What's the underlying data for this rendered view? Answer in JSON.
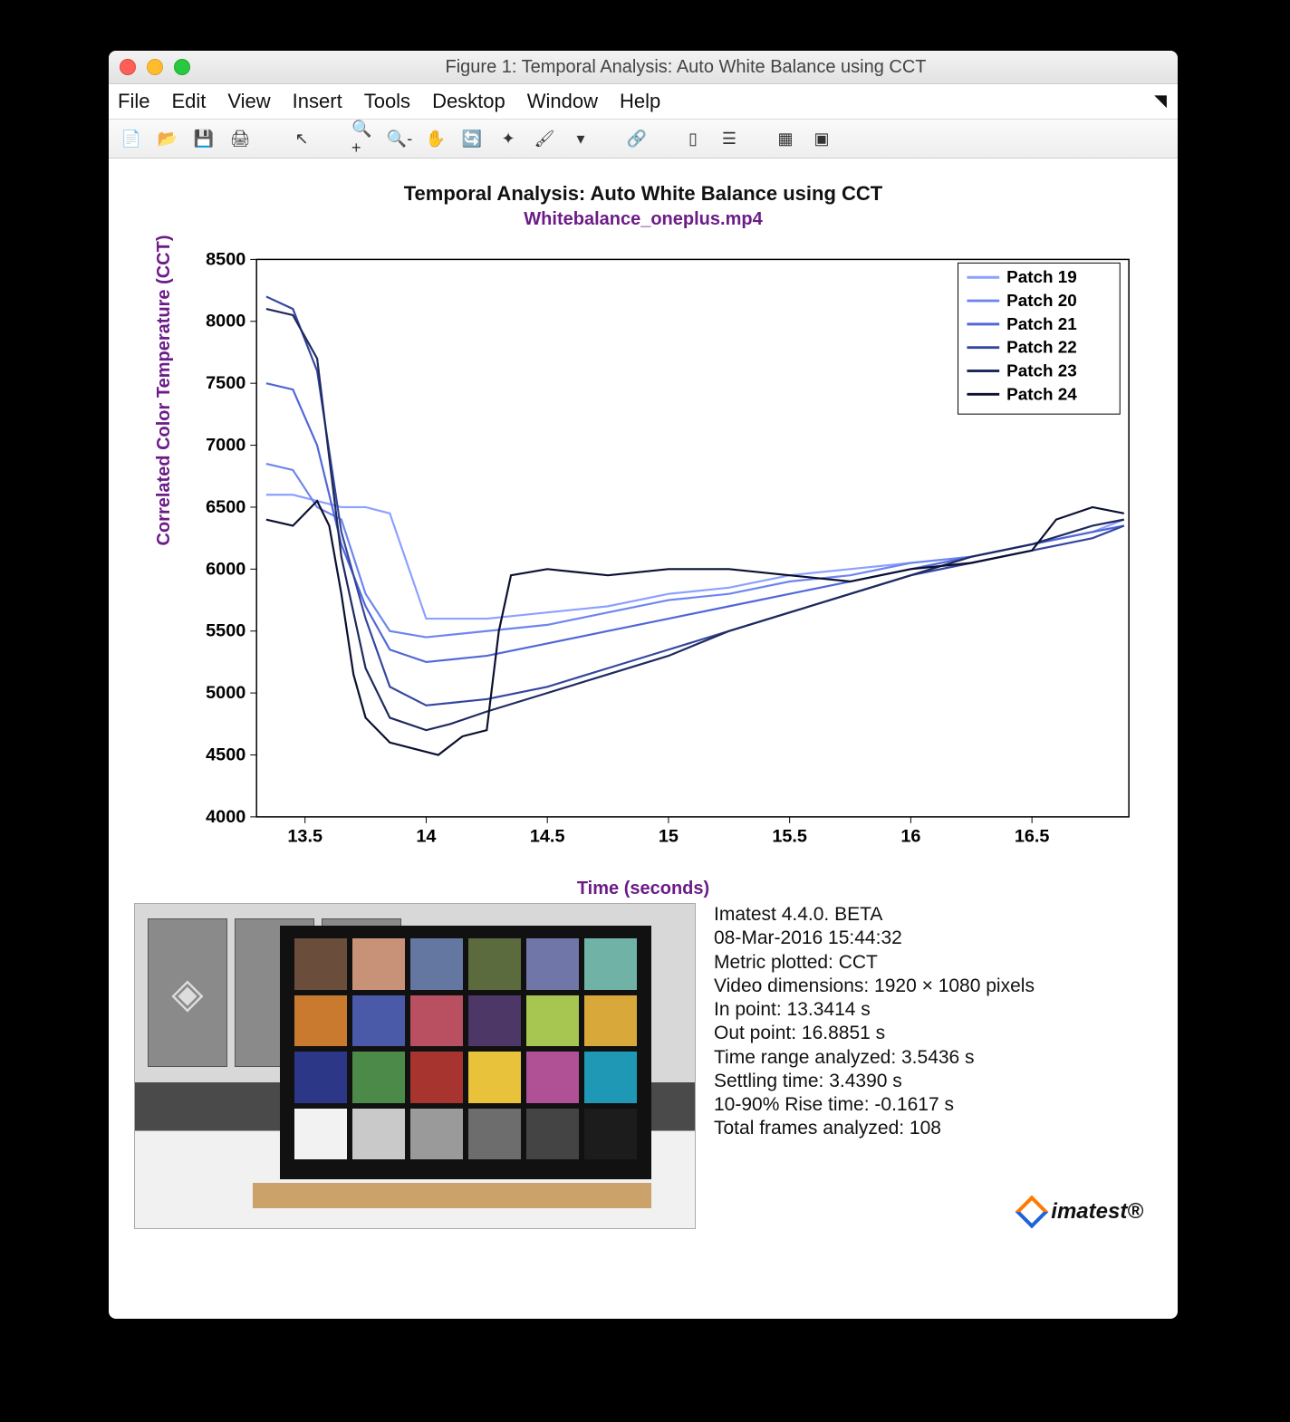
{
  "window": {
    "title": "Figure 1: Temporal Analysis: Auto White Balance using CCT"
  },
  "menu": [
    "File",
    "Edit",
    "View",
    "Insert",
    "Tools",
    "Desktop",
    "Window",
    "Help"
  ],
  "chart": {
    "title": "Temporal Analysis: Auto White Balance using CCT",
    "subtitle": "Whitebalance_oneplus.mp4",
    "ylabel": "Correlated Color Temperature (CCT)",
    "xlabel": "Time (seconds)"
  },
  "info": {
    "l1": "Imatest 4.4.0. BETA",
    "l2": "08-Mar-2016 15:44:32",
    "l3": "Metric plotted: CCT",
    "l4": "Video dimensions: 1920 × 1080 pixels",
    "l5": "In point: 13.3414 s",
    "l6": "Out point: 16.8851 s",
    "l7": "Time range analyzed: 3.5436 s",
    "l8": "Settling time: 3.4390 s",
    "l9": "10-90% Rise time: -0.1617 s",
    "l10": "Total frames analyzed: 108"
  },
  "logo": "imatest®",
  "chart_data": {
    "type": "line",
    "xlabel": "Time (seconds)",
    "ylabel": "Correlated Color Temperature (CCT)",
    "xlim": [
      13.3,
      16.9
    ],
    "ylim": [
      4000,
      8500
    ],
    "xticks": [
      13.5,
      14,
      14.5,
      15,
      15.5,
      16,
      16.5
    ],
    "yticks": [
      4000,
      4500,
      5000,
      5500,
      6000,
      6500,
      7000,
      7500,
      8000,
      8500
    ],
    "legend_position": "top-right",
    "series": [
      {
        "name": "Patch 19",
        "color": "#8ca0ff",
        "x": [
          13.34,
          13.45,
          13.55,
          13.65,
          13.75,
          13.85,
          14.0,
          14.25,
          14.5,
          14.75,
          15.0,
          15.25,
          15.5,
          15.75,
          16.0,
          16.25,
          16.5,
          16.75,
          16.88
        ],
        "y": [
          6600,
          6600,
          6550,
          6500,
          6500,
          6450,
          5600,
          5600,
          5650,
          5700,
          5800,
          5850,
          5950,
          6000,
          6050,
          6100,
          6200,
          6300,
          6400
        ]
      },
      {
        "name": "Patch 20",
        "color": "#6d85ef",
        "x": [
          13.34,
          13.45,
          13.55,
          13.65,
          13.75,
          13.85,
          14.0,
          14.25,
          14.5,
          14.75,
          15.0,
          15.25,
          15.5,
          15.75,
          16.0,
          16.25,
          16.5,
          16.75,
          16.88
        ],
        "y": [
          6850,
          6800,
          6500,
          6400,
          5800,
          5500,
          5450,
          5500,
          5550,
          5650,
          5750,
          5800,
          5900,
          5950,
          6050,
          6100,
          6200,
          6300,
          6350
        ]
      },
      {
        "name": "Patch 21",
        "color": "#5167d8",
        "x": [
          13.34,
          13.45,
          13.55,
          13.65,
          13.75,
          13.85,
          14.0,
          14.25,
          14.5,
          14.75,
          15.0,
          15.25,
          15.5,
          15.75,
          16.0,
          16.25,
          16.5,
          16.75,
          16.88
        ],
        "y": [
          7500,
          7450,
          7000,
          6200,
          5700,
          5350,
          5250,
          5300,
          5400,
          5500,
          5600,
          5700,
          5800,
          5900,
          6000,
          6100,
          6200,
          6300,
          6350
        ]
      },
      {
        "name": "Patch 22",
        "color": "#34469f",
        "x": [
          13.34,
          13.45,
          13.55,
          13.65,
          13.75,
          13.85,
          14.0,
          14.25,
          14.5,
          14.75,
          15.0,
          15.25,
          15.5,
          15.75,
          16.0,
          16.25,
          16.5,
          16.75,
          16.88
        ],
        "y": [
          8200,
          8100,
          7600,
          6300,
          5600,
          5050,
          4900,
          4950,
          5050,
          5200,
          5350,
          5500,
          5650,
          5800,
          5950,
          6050,
          6150,
          6250,
          6350
        ]
      },
      {
        "name": "Patch 23",
        "color": "#1e2a5e",
        "x": [
          13.34,
          13.45,
          13.55,
          13.65,
          13.75,
          13.85,
          14.0,
          14.1,
          14.25,
          14.5,
          14.75,
          15.0,
          15.25,
          15.5,
          15.75,
          16.0,
          16.25,
          16.5,
          16.75,
          16.88
        ],
        "y": [
          8100,
          8050,
          7700,
          6100,
          5200,
          4800,
          4700,
          4750,
          4850,
          5000,
          5150,
          5300,
          5500,
          5650,
          5800,
          5950,
          6100,
          6200,
          6350,
          6400
        ]
      },
      {
        "name": "Patch 24",
        "color": "#0b1030",
        "x": [
          13.34,
          13.45,
          13.55,
          13.6,
          13.65,
          13.7,
          13.75,
          13.85,
          13.95,
          14.05,
          14.15,
          14.25,
          14.3,
          14.35,
          14.5,
          14.75,
          15.0,
          15.25,
          15.5,
          15.75,
          16.0,
          16.25,
          16.5,
          16.6,
          16.75,
          16.88
        ],
        "y": [
          6400,
          6350,
          6550,
          6350,
          5800,
          5150,
          4800,
          4600,
          4550,
          4500,
          4650,
          4700,
          5500,
          5950,
          6000,
          5950,
          6000,
          6000,
          5950,
          5900,
          6000,
          6050,
          6150,
          6400,
          6500,
          6450
        ]
      }
    ]
  },
  "swatches": [
    "#6a4d3a",
    "#c79277",
    "#6477a0",
    "#5c6b3e",
    "#7076a8",
    "#70b3a6",
    "#c97a2f",
    "#4a5aa8",
    "#b95061",
    "#4c3766",
    "#a6c651",
    "#d8a83a",
    "#2c3887",
    "#4c8a4a",
    "#a8342f",
    "#e8c23a",
    "#b15195",
    "#1f98b5",
    "#f2f2f2",
    "#c9c9c9",
    "#9a9a9a",
    "#6d6d6d",
    "#444444",
    "#1c1c1c"
  ]
}
